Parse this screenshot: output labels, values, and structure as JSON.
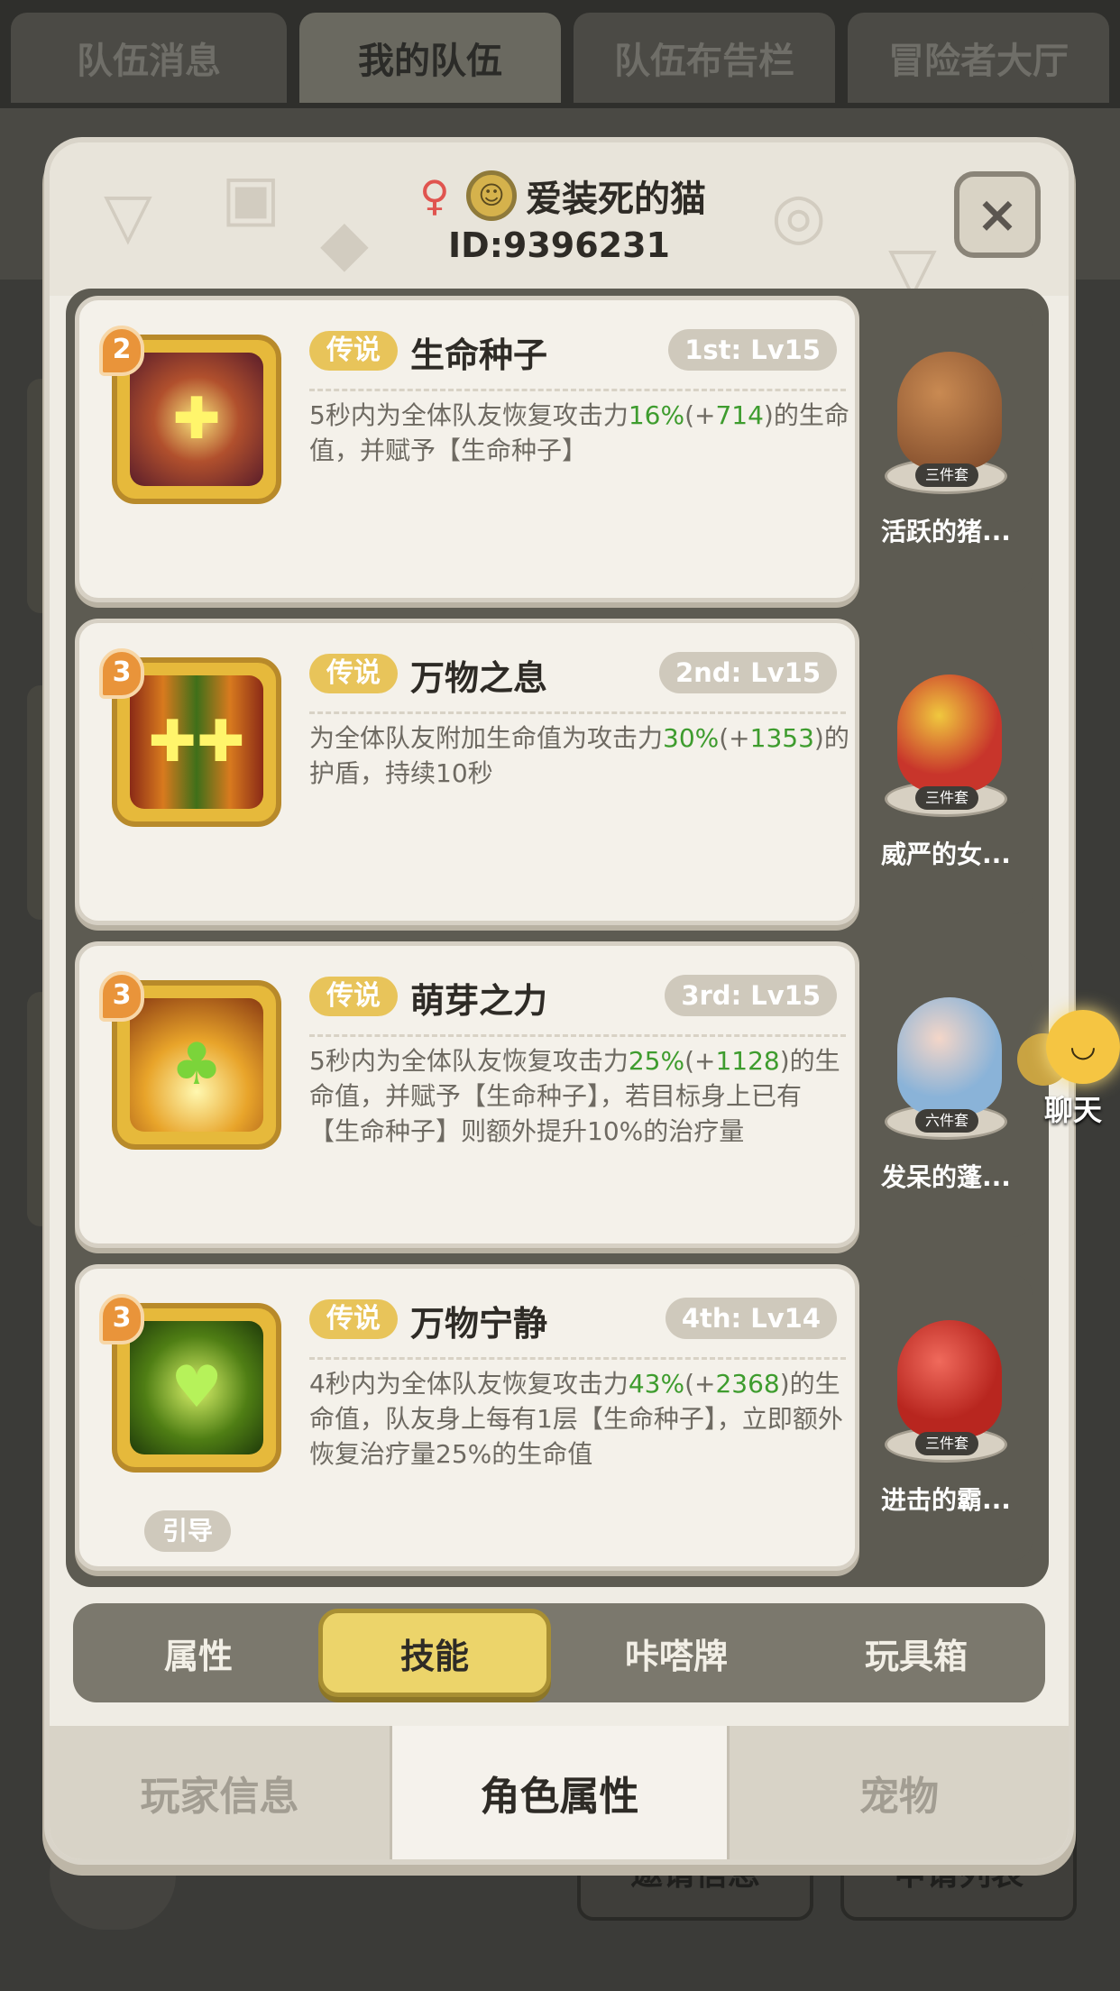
{
  "background_tabs": [
    "队伍消息",
    "我的队伍",
    "队伍布告栏",
    "冒险者大厅"
  ],
  "background_bottom_buttons": [
    "邀请信息",
    "申请列表"
  ],
  "player": {
    "name": "爱装死的猫",
    "id_text": "ID:9396231"
  },
  "close_label": "×",
  "skills": [
    {
      "level": "2",
      "rarity": "传说",
      "name": "生命种子",
      "slot": "1st: Lv15",
      "desc_parts": [
        "5秒内为全体队友恢复攻击力",
        "16%",
        "(+",
        "714",
        ")的生命值，并赋予【生命种子】"
      ],
      "pet": {
        "name": "活跃的猪...",
        "set": "三件套"
      }
    },
    {
      "level": "3",
      "rarity": "传说",
      "name": "万物之息",
      "slot": "2nd: Lv15",
      "desc_parts": [
        "为全体队友附加生命值为攻击力",
        "30%",
        "(+",
        "1353",
        ")的护盾，持续10秒"
      ],
      "pet": {
        "name": "威严的女...",
        "set": "三件套"
      }
    },
    {
      "level": "3",
      "rarity": "传说",
      "name": "萌芽之力",
      "slot": "3rd: Lv15",
      "desc_parts": [
        "5秒内为全体队友恢复攻击力",
        "25%",
        "(+",
        "1128",
        ")的生命值，并赋予【生命种子】，若目标身上已有【生命种子】则额外提升10%的治疗量"
      ],
      "pet": {
        "name": "发呆的蓬...",
        "set": "六件套"
      }
    },
    {
      "level": "3",
      "rarity": "传说",
      "name": "万物宁静",
      "slot": "4th: Lv14",
      "desc_parts": [
        "4秒内为全体队友恢复攻击力",
        "43%",
        "(+",
        "2368",
        ")的生命值，队友身上每有1层【生命种子】，立即额外恢复治疗量25%的生命值"
      ],
      "pet": {
        "name": "进击的霸...",
        "set": "三件套"
      },
      "guide_label": "引导"
    }
  ],
  "chat_label": "聊天",
  "sub_tabs": [
    "属性",
    "技能",
    "咔嗒牌",
    "玩具箱"
  ],
  "active_sub_tab": "技能",
  "bottom_tabs": [
    "玩家信息",
    "角色属性",
    "宠物"
  ],
  "active_bottom_tab": "角色属性",
  "colors": {
    "accent_yellow": "#ecd46a",
    "highlight_green": "#3e9c2e",
    "panel_dark": "#5d5b52"
  }
}
